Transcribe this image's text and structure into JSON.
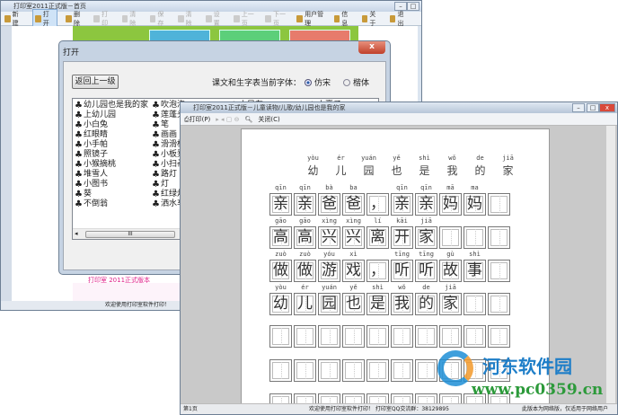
{
  "main_window": {
    "title": "打印室2011正式版－首页",
    "toolbar": [
      {
        "label": "新 建",
        "icon": "new-icon",
        "enabled": true
      },
      {
        "label": "打 开",
        "icon": "folder-open-icon",
        "enabled": true,
        "active": true
      },
      {
        "label": "删 除",
        "icon": "delete-icon",
        "enabled": true
      },
      {
        "label": "打 印",
        "icon": "print-icon",
        "enabled": false
      },
      {
        "label": "清 除",
        "icon": "clear-icon",
        "enabled": false
      },
      {
        "label": "保 存",
        "icon": "save-icon",
        "enabled": false
      },
      {
        "label": "清 除",
        "icon": "erase-icon",
        "enabled": false
      },
      {
        "label": "设 置",
        "icon": "settings-icon",
        "enabled": false
      },
      {
        "label": "上一页",
        "icon": "prev-page-icon",
        "enabled": false
      },
      {
        "label": "下一页",
        "icon": "next-page-icon",
        "enabled": false
      },
      {
        "label": "用户管理",
        "icon": "user-icon",
        "enabled": true
      },
      {
        "label": "信 息",
        "icon": "info-icon",
        "enabled": true
      },
      {
        "label": "关 于",
        "icon": "about-icon",
        "enabled": true
      },
      {
        "label": "退 出",
        "icon": "exit-icon",
        "enabled": true
      }
    ],
    "banner_text": "欢迎使用打印室软件打印",
    "promo_text": "打印室 2011正式版本",
    "status": "欢迎使用打印室软件打印！"
  },
  "dialog": {
    "title": "打开",
    "close": "x",
    "back_button": "返回上一级",
    "font_label": "课文和生字表当前字体：",
    "font_options": [
      {
        "label": "仿宋",
        "selected": true
      },
      {
        "label": "楷体",
        "selected": false
      }
    ],
    "col1": [
      "幼儿园也是我的家",
      "上幼儿园",
      "小白兔",
      "红眼睛",
      "小手帕",
      "照镜子",
      "小猴摘桃",
      "堆雪人",
      "小图书",
      "葵",
      "不倒翁"
    ],
    "col2": [
      "吹泡泡",
      "莲蓬头",
      "笔",
      "画画",
      "滑滑梯",
      "小板凳",
      "小扫帚",
      "路灯",
      "灯",
      "红绿灯",
      "洒水车"
    ],
    "col3": [
      "小风车"
    ],
    "col4": [
      "小裹子"
    ],
    "scroll_grip": "III"
  },
  "preview": {
    "title": "打印室2011正式版－儿童读物/儿歌/幼儿园也是我的家",
    "toolbar": {
      "print": "打印(P)",
      "close": "关闭(C)"
    },
    "doc_title": [
      {
        "py": "yòu",
        "ch": "幼"
      },
      {
        "py": "ér",
        "ch": "儿"
      },
      {
        "py": "yuán",
        "ch": "园"
      },
      {
        "py": "yě",
        "ch": "也"
      },
      {
        "py": "shì",
        "ch": "是"
      },
      {
        "py": "wǒ",
        "ch": "我"
      },
      {
        "py": "de",
        "ch": "的"
      },
      {
        "py": "jiā",
        "ch": "家"
      }
    ],
    "rows": [
      [
        {
          "py": "qīn",
          "ch": "亲"
        },
        {
          "py": "qīn",
          "ch": "亲"
        },
        {
          "py": "bà",
          "ch": "爸"
        },
        {
          "py": "ba",
          "ch": "爸"
        },
        {
          "py": "",
          "ch": "，"
        },
        {
          "py": "qīn",
          "ch": "亲"
        },
        {
          "py": "qīn",
          "ch": "亲"
        },
        {
          "py": "mā",
          "ch": "妈"
        },
        {
          "py": "ma",
          "ch": "妈"
        },
        {
          "py": "",
          "ch": ""
        }
      ],
      [
        {
          "py": "gāo",
          "ch": "高"
        },
        {
          "py": "gāo",
          "ch": "高"
        },
        {
          "py": "xìng",
          "ch": "兴"
        },
        {
          "py": "xìng",
          "ch": "兴"
        },
        {
          "py": "lí",
          "ch": "离"
        },
        {
          "py": "kāi",
          "ch": "开"
        },
        {
          "py": "jiā",
          "ch": "家"
        },
        {
          "py": "",
          "ch": ""
        },
        {
          "py": "",
          "ch": ""
        },
        {
          "py": "",
          "ch": ""
        }
      ],
      [
        {
          "py": "zuò",
          "ch": "做"
        },
        {
          "py": "zuò",
          "ch": "做"
        },
        {
          "py": "yóu",
          "ch": "游"
        },
        {
          "py": "xì",
          "ch": "戏"
        },
        {
          "py": "",
          "ch": "，"
        },
        {
          "py": "tīng",
          "ch": "听"
        },
        {
          "py": "tīng",
          "ch": "听"
        },
        {
          "py": "gù",
          "ch": "故"
        },
        {
          "py": "shì",
          "ch": "事"
        },
        {
          "py": "",
          "ch": ""
        }
      ],
      [
        {
          "py": "yòu",
          "ch": "幼"
        },
        {
          "py": "ér",
          "ch": "儿"
        },
        {
          "py": "yuán",
          "ch": "园"
        },
        {
          "py": "yě",
          "ch": "也"
        },
        {
          "py": "shì",
          "ch": "是"
        },
        {
          "py": "wǒ",
          "ch": "我"
        },
        {
          "py": "de",
          "ch": "的"
        },
        {
          "py": "jiā",
          "ch": "家"
        },
        {
          "py": "",
          "ch": ""
        },
        {
          "py": "",
          "ch": ""
        }
      ]
    ],
    "empty_rows": 3,
    "status_left": "第1页",
    "status_center": "欢迎使用打印室软件打印！  打印室QQ交流群：38129895",
    "status_right": "此版本为网络版，仅适用于网络用户"
  },
  "watermark": {
    "name": "河东软件园",
    "url": "www.pc0359.cn"
  }
}
